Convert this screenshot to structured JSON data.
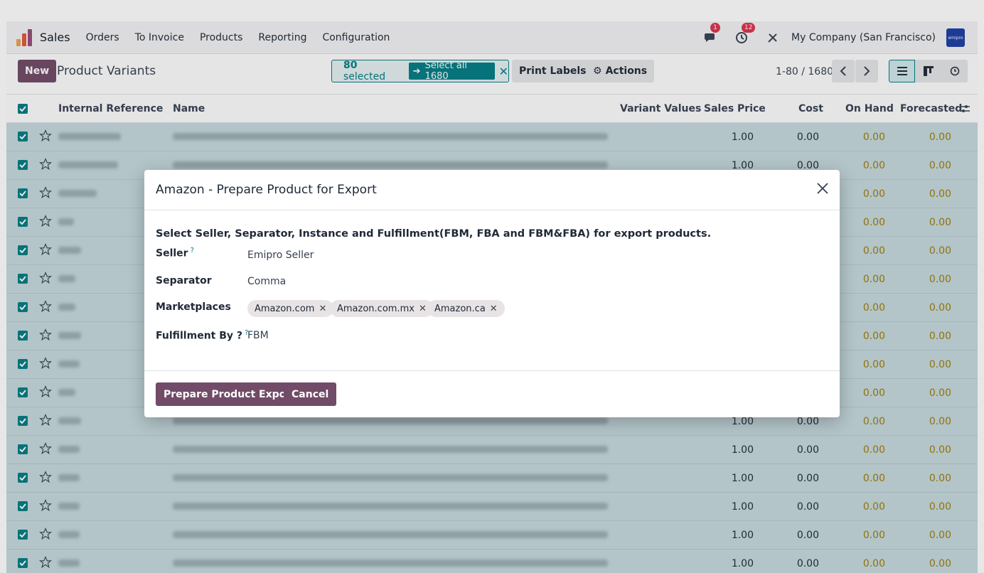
{
  "navbar": {
    "app_name": "Sales",
    "menu": [
      "Orders",
      "To Invoice",
      "Products",
      "Reporting",
      "Configuration"
    ],
    "messages_badge": "1",
    "activities_badge": "12",
    "company": "My Company (San Francisco)",
    "company_logo_text": "emipro"
  },
  "control": {
    "new_label": "New",
    "title": "Product Variants",
    "selected_count": "80",
    "selected_suffix": "selected",
    "select_all_label": "Select all 1680",
    "print_labels": "Print Labels",
    "actions": "Actions",
    "pager": "1-80 / 1680"
  },
  "table": {
    "headers": {
      "internal_reference": "Internal Reference",
      "name": "Name",
      "variant_values": "Variant Values",
      "sales_price": "Sales Price",
      "cost": "Cost",
      "on_hand": "On Hand",
      "forecasted": "Forecasted"
    },
    "rows": [
      {
        "price": "1.00",
        "cost": "0.00",
        "on_hand": "0.00",
        "forecasted": "0.00"
      },
      {
        "price": "1.00",
        "cost": "0.00",
        "on_hand": "0.00",
        "forecasted": "0.00"
      },
      {
        "price": "",
        "cost": "",
        "on_hand": "0.00",
        "forecasted": "0.00"
      },
      {
        "price": "",
        "cost": "",
        "on_hand": "0.00",
        "forecasted": "0.00"
      },
      {
        "price": "",
        "cost": "",
        "on_hand": "0.00",
        "forecasted": "0.00"
      },
      {
        "price": "",
        "cost": "",
        "on_hand": "0.00",
        "forecasted": "0.00"
      },
      {
        "price": "",
        "cost": "",
        "on_hand": "0.00",
        "forecasted": "0.00"
      },
      {
        "price": "",
        "cost": "",
        "on_hand": "0.00",
        "forecasted": "0.00"
      },
      {
        "price": "",
        "cost": "",
        "on_hand": "0.00",
        "forecasted": "0.00"
      },
      {
        "price": "",
        "cost": "",
        "on_hand": "0.00",
        "forecasted": "0.00"
      },
      {
        "price": "1.00",
        "cost": "0.00",
        "on_hand": "0.00",
        "forecasted": "0.00"
      },
      {
        "price": "1.00",
        "cost": "0.00",
        "on_hand": "0.00",
        "forecasted": "0.00"
      },
      {
        "price": "1.00",
        "cost": "0.00",
        "on_hand": "0.00",
        "forecasted": "0.00"
      },
      {
        "price": "1.00",
        "cost": "0.00",
        "on_hand": "0.00",
        "forecasted": "0.00"
      },
      {
        "price": "1.00",
        "cost": "0.00",
        "on_hand": "0.00",
        "forecasted": "0.00"
      },
      {
        "price": "1.00",
        "cost": "0.00",
        "on_hand": "0.00",
        "forecasted": "0.00"
      }
    ]
  },
  "modal": {
    "title": "Amazon - Prepare Product for Export",
    "intro": "Select Seller, Separator, Instance and Fulfillment(FBM, FBA and FBM&FBA) for export products.",
    "seller_label": "Seller",
    "seller_value": "Emipro Seller",
    "separator_label": "Separator",
    "separator_value": "Comma",
    "marketplaces_label": "Marketplaces",
    "marketplaces": [
      "Amazon.com",
      "Amazon.com.mx",
      "Amazon.ca"
    ],
    "fulfillment_label": "Fulfillment By ?",
    "fulfillment_value": "FBM",
    "help_mark": "?",
    "primary_button": "Prepare Product Export",
    "cancel_button": "Cancel"
  }
}
